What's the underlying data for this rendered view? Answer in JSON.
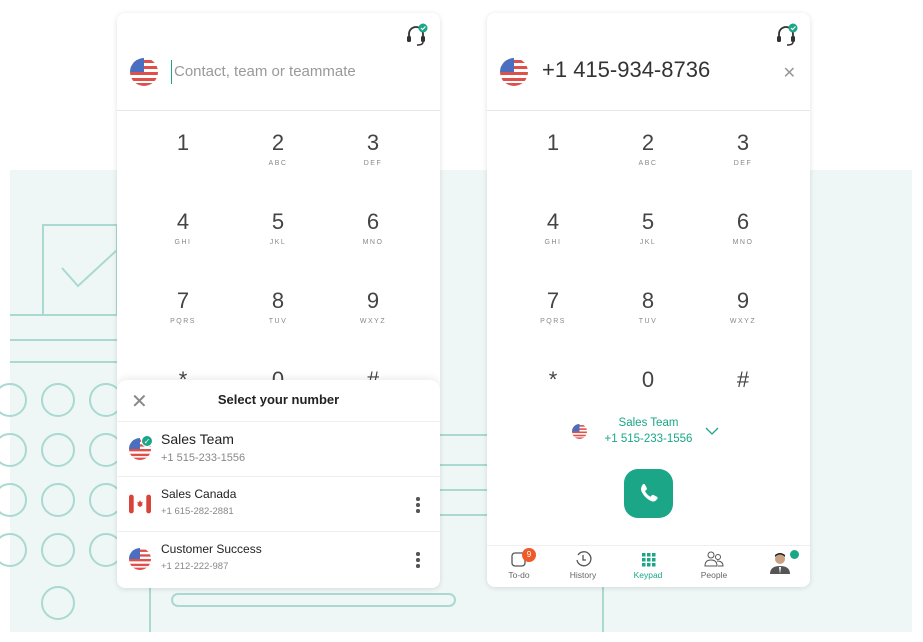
{
  "colors": {
    "accent": "#1aa687",
    "badge": "#f05a28",
    "background_art": "#eef7f6"
  },
  "left_dialer": {
    "input": {
      "placeholder": "Contact, team or teammate",
      "value": ""
    },
    "keys": [
      {
        "d": "1",
        "l": ""
      },
      {
        "d": "2",
        "l": "ABC"
      },
      {
        "d": "3",
        "l": "DEF"
      },
      {
        "d": "4",
        "l": "GHI"
      },
      {
        "d": "5",
        "l": "JKL"
      },
      {
        "d": "6",
        "l": "MNO"
      },
      {
        "d": "7",
        "l": "PQRS"
      },
      {
        "d": "8",
        "l": "TUV"
      },
      {
        "d": "9",
        "l": "WXYZ"
      },
      {
        "d": "*",
        "l": ""
      },
      {
        "d": "0",
        "l": ""
      },
      {
        "d": "#",
        "l": ""
      }
    ],
    "sheet": {
      "title": "Select your number",
      "items": [
        {
          "name": "Sales Team",
          "phone": "+1 515-233-1556",
          "flag": "us",
          "selected": true
        },
        {
          "name": "Sales Canada",
          "phone": "+1 615-282-2881",
          "flag": "ca",
          "selected": false
        },
        {
          "name": "Customer Success",
          "phone": "+1 212-222-987",
          "flag": "us",
          "selected": false
        }
      ]
    }
  },
  "right_dialer": {
    "number": "+1 415-934-8736",
    "clear_icon": "close-icon",
    "caller": {
      "name": "Sales Team",
      "phone": "+1 515-233-1556"
    },
    "nav": [
      {
        "label": "To-do",
        "badge": "9"
      },
      {
        "label": "History"
      },
      {
        "label": "Keypad",
        "active": true
      },
      {
        "label": "People"
      },
      {
        "label": "",
        "icon": "avatar",
        "status": "online"
      }
    ]
  }
}
